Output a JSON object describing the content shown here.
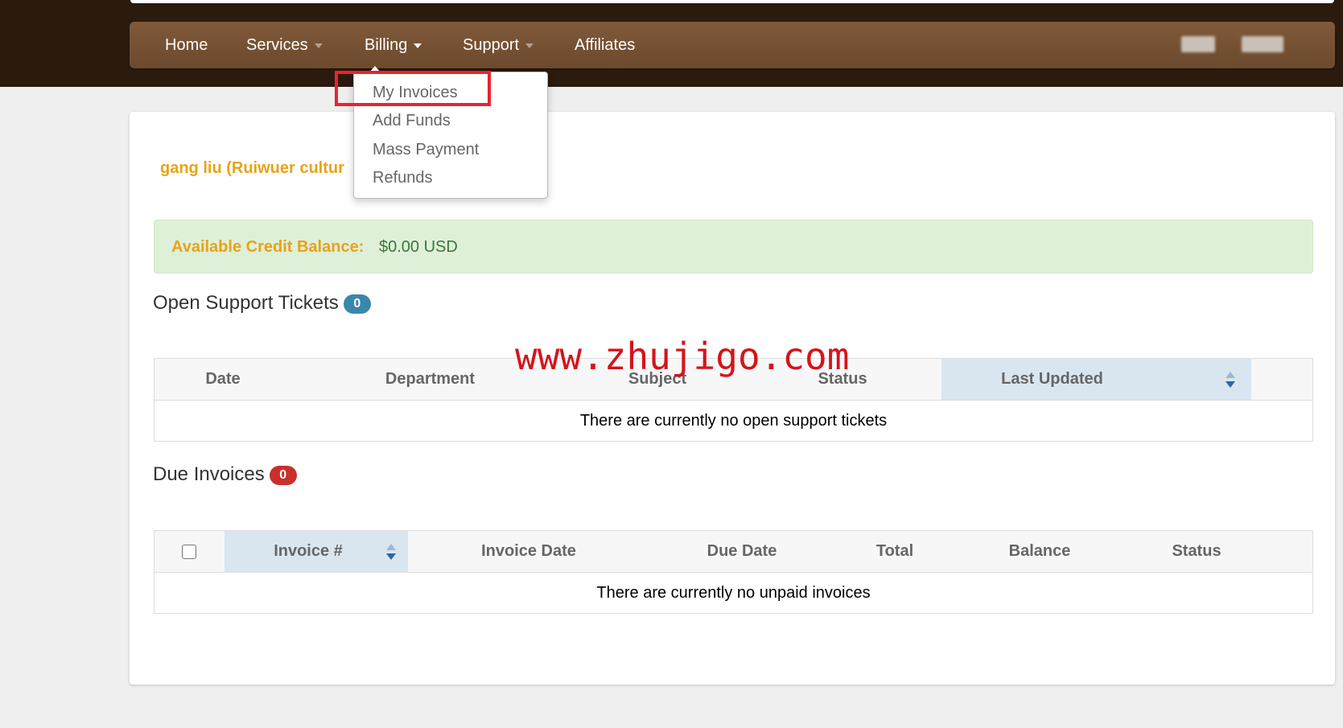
{
  "nav": {
    "items": [
      {
        "label": "Home",
        "has_caret": false
      },
      {
        "label": "Services",
        "has_caret": true
      },
      {
        "label": "Billing",
        "has_caret": true
      },
      {
        "label": "Support",
        "has_caret": true
      },
      {
        "label": "Affiliates",
        "has_caret": false
      }
    ]
  },
  "billing_menu": {
    "items": [
      "My Invoices",
      "Add Funds",
      "Mass Payment",
      "Refunds"
    ]
  },
  "account": {
    "name": "gang liu (Ruiwuer cultur"
  },
  "credit": {
    "label": "Available Credit Balance:",
    "value": "$0.00 USD"
  },
  "tickets": {
    "title": "Open Support Tickets",
    "count": "0",
    "columns": [
      "Date",
      "Department",
      "Subject",
      "Status",
      "Last Updated"
    ],
    "empty_message": "There are currently no open support tickets"
  },
  "invoices": {
    "title": "Due Invoices",
    "count": "0",
    "columns": [
      "Invoice #",
      "Invoice Date",
      "Due Date",
      "Total",
      "Balance",
      "Status"
    ],
    "empty_message": "There are currently no unpaid invoices"
  },
  "watermark": "www.zhujigo.com",
  "colors": {
    "accent_orange": "#e8a317",
    "ticket_badge": "#3a87ad",
    "invoice_badge": "#c9302c",
    "highlight_red": "#e8242f",
    "navbar_brown": "#76512f"
  }
}
